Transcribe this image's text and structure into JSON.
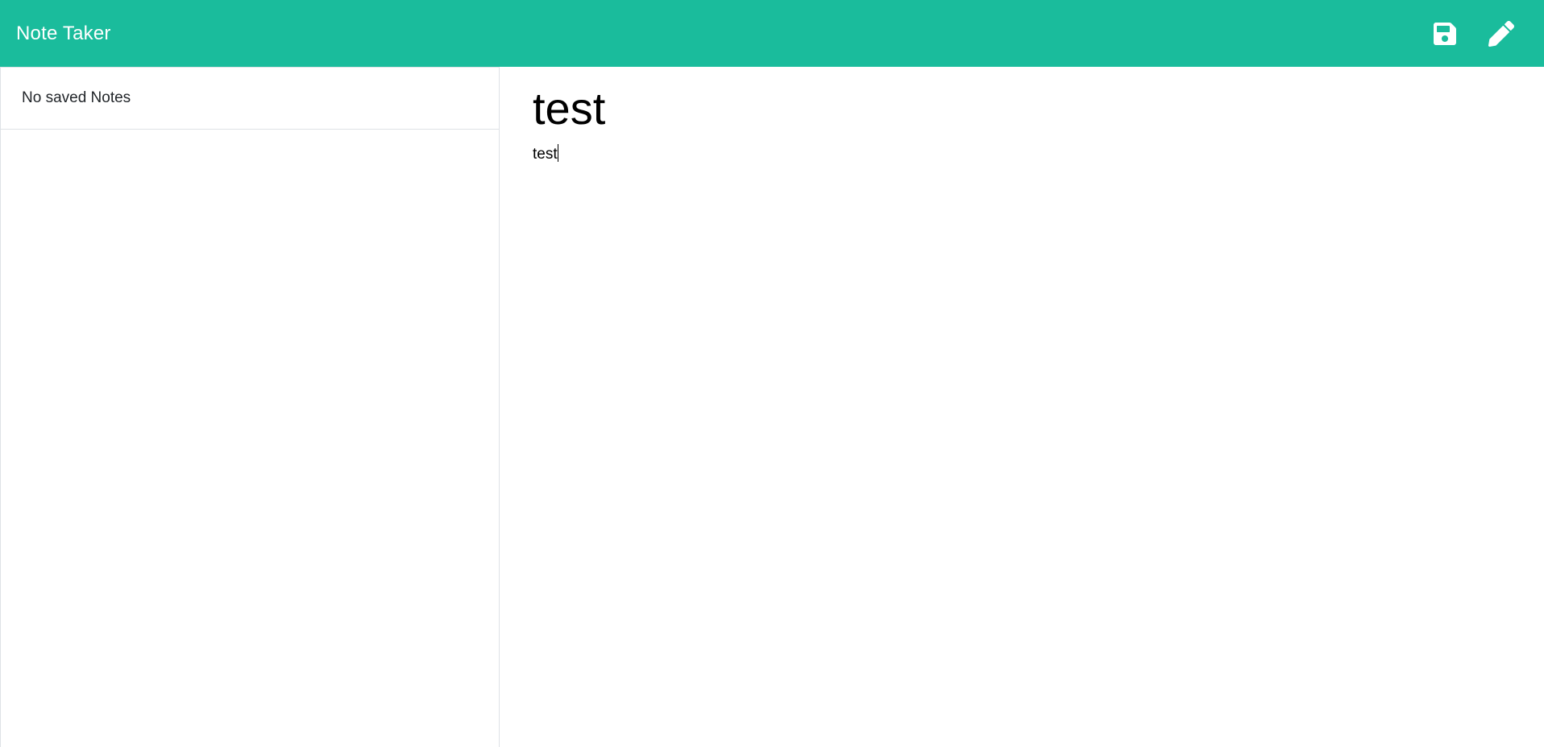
{
  "navbar": {
    "brand": "Note Taker",
    "save_icon": "save-icon",
    "new_note_icon": "pencil-icon",
    "accent_color": "#1abc9c"
  },
  "sidebar": {
    "empty_message": "No saved Notes"
  },
  "editor": {
    "title_value": "test",
    "body_value": "test"
  }
}
